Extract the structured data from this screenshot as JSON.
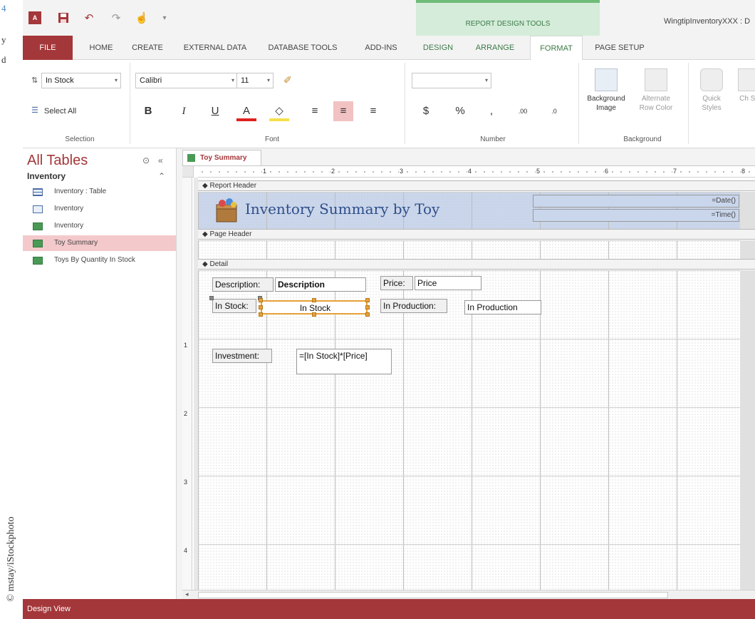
{
  "margin": {
    "figure_number": "4",
    "text_fragments": [
      "y",
      "d"
    ],
    "credit": "© mstay/iStockphoto"
  },
  "titlebar": {
    "context_header": "REPORT DESIGN TOOLS",
    "app_title": "WingtipInventoryXXX : D"
  },
  "tabs": [
    {
      "label": "FILE"
    },
    {
      "label": "HOME"
    },
    {
      "label": "CREATE"
    },
    {
      "label": "EXTERNAL DATA"
    },
    {
      "label": "DATABASE TOOLS"
    },
    {
      "label": "ADD-INS"
    },
    {
      "label": "DESIGN"
    },
    {
      "label": "ARRANGE"
    },
    {
      "label": "FORMAT"
    },
    {
      "label": "PAGE SETUP"
    }
  ],
  "ribbon": {
    "selection": {
      "combo_value": "In Stock",
      "select_all": "Select All",
      "label": "Selection"
    },
    "font": {
      "family": "Calibri",
      "size": "11",
      "bold": "B",
      "italic": "I",
      "underline": "U",
      "font_color": "A",
      "label": "Font"
    },
    "number": {
      "format_value": "",
      "currency": "$",
      "percent": "%",
      "comma": ",",
      "increase_decimals": ".00",
      "decrease_decimals": ".0",
      "label": "Number"
    },
    "background": {
      "background_image": "Background Image",
      "alternate_row_color": "Alternate Row Color",
      "label": "Background"
    },
    "control_formatting": {
      "quick_styles": "Quick Styles",
      "change_shape": "Ch Sh"
    }
  },
  "nav": {
    "title": "All Tables",
    "group": "Inventory",
    "items": [
      {
        "label": "Inventory : Table",
        "type": "table"
      },
      {
        "label": "Inventory",
        "type": "form"
      },
      {
        "label": "Inventory",
        "type": "report"
      },
      {
        "label": "Toy Summary",
        "type": "report",
        "selected": true
      },
      {
        "label": "Toys By Quantity In Stock",
        "type": "report"
      }
    ]
  },
  "document": {
    "tab_label": "Toy Summary",
    "ruler_numbers": [
      "1",
      "2",
      "3",
      "4",
      "5",
      "6",
      "7",
      "8"
    ],
    "vruler_numbers": [
      "1",
      "2",
      "3",
      "4"
    ],
    "sections": {
      "report_header": "Report Header",
      "page_header": "Page Header",
      "detail": "Detail"
    },
    "report_title": "Inventory Summary by Toy",
    "date_expr": "=Date()",
    "time_expr": "=Time()",
    "controls": {
      "description_label": "Description:",
      "description_field": "Description",
      "price_label": "Price:",
      "price_field": "Price",
      "in_stock_label": "In Stock:",
      "in_stock_field": "In Stock",
      "in_production_label": "In Production:",
      "in_production_field": "In Production",
      "investment_label": "Investment:",
      "investment_expr": "=[In Stock]*[Price]"
    }
  },
  "status": {
    "view": "Design View"
  },
  "colors": {
    "access_red": "#a4373a",
    "context_green": "#3c7a48",
    "selection_orange": "#e8a13a",
    "header_blue": "#c9d6ec"
  }
}
